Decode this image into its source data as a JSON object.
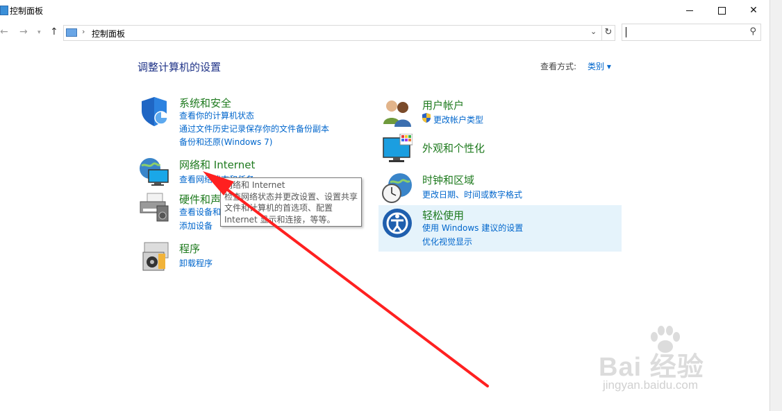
{
  "window": {
    "title": "控制面板",
    "controls": [
      "minimize",
      "maximize",
      "close"
    ]
  },
  "address_bar": {
    "path": "控制面板",
    "search_placeholder": ""
  },
  "main": {
    "heading": "调整计算机的设置",
    "view_by_label": "查看方式:",
    "view_by_value": "类别 ▾",
    "categories": [
      {
        "title": "系统和安全",
        "icon": "shield-icon",
        "links": [
          "查看你的计算机状态",
          "通过文件历史记录保存你的文件备份副本",
          "备份和还原(Windows 7)"
        ]
      },
      {
        "title": "网络和 Internet",
        "icon": "network-icon",
        "links": [
          "查看网络状态和任务"
        ]
      },
      {
        "title": "硬件和声音",
        "icon": "printer-icon",
        "links": [
          "查看设备和打印机",
          "添加设备"
        ]
      },
      {
        "title": "程序",
        "icon": "programs-icon",
        "links": [
          "卸载程序"
        ]
      },
      {
        "title": "用户帐户",
        "icon": "users-icon",
        "links": [
          "更改帐户类型"
        ]
      },
      {
        "title": "外观和个性化",
        "icon": "monitor-icon",
        "links": []
      },
      {
        "title": "时钟和区域",
        "icon": "clock-globe-icon",
        "links": [
          "更改日期、时间或数字格式"
        ]
      },
      {
        "title": "轻松使用",
        "icon": "ease-of-access-icon",
        "links": [
          "使用 Windows 建议的设置",
          "优化视觉显示"
        ]
      }
    ]
  },
  "tooltip": {
    "lines": [
      "网络和 Internet",
      "检查网络状态并更改设置、设置共享",
      "文件和计算机的首选项、配置",
      "Internet 显示和连接，等等。"
    ]
  },
  "watermark": {
    "main": "Bai 经验",
    "sub": "jingyan.baidu.com"
  },
  "colors": {
    "category_title": "#1e7a1e",
    "link": "#0066cc",
    "heading": "#1e3287",
    "hover": "#e5f3fb",
    "annotation_arrow": "#ff2020"
  }
}
